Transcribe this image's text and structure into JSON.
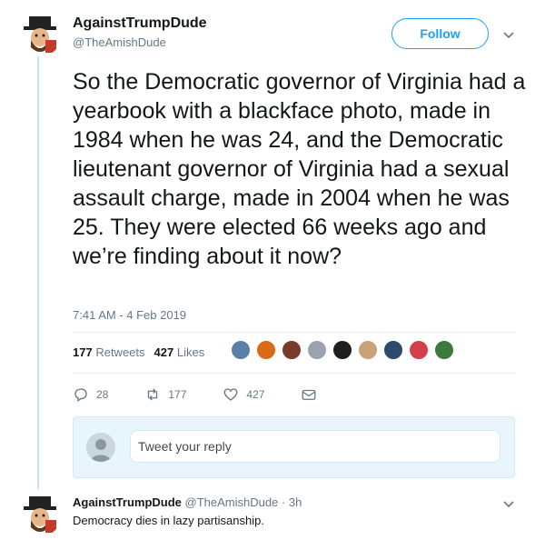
{
  "tweet": {
    "author_name": "AgainstTrumpDude",
    "author_handle": "@TheAmishDude",
    "follow_label": "Follow",
    "text": "So the Democratic governor of Virginia had a yearbook with a blackface photo, made in 1984 when he was 24, and the Democratic lieutenant governor of Virginia had a sexual assault charge, made in 2004 when he was 25. They were elected 66 weeks ago and we’re finding about it now?",
    "timestamp": "7:41 AM - 4 Feb 2019",
    "retweets_count": "177",
    "retweets_label": "Retweets",
    "likes_count": "427",
    "likes_label": "Likes",
    "actions": {
      "reply_count": "28",
      "retweet_count": "177",
      "like_count": "427"
    }
  },
  "liker_colors": [
    "#5b7fa8",
    "#d96a1b",
    "#7a3a2a",
    "#9aa3ad",
    "#1e1e1e",
    "#c9a27a",
    "#2c4a6b",
    "#d4404a",
    "#3e7a3e"
  ],
  "reply_box": {
    "placeholder": "Tweet your reply"
  },
  "reply": {
    "author_name": "AgainstTrumpDude",
    "meta": "@TheAmishDude · 3h",
    "text": "Democracy dies in lazy partisanship."
  },
  "colors": {
    "accent": "#1da1f2",
    "secondary_text": "#657786",
    "thread_line": "#c4e4fb"
  }
}
